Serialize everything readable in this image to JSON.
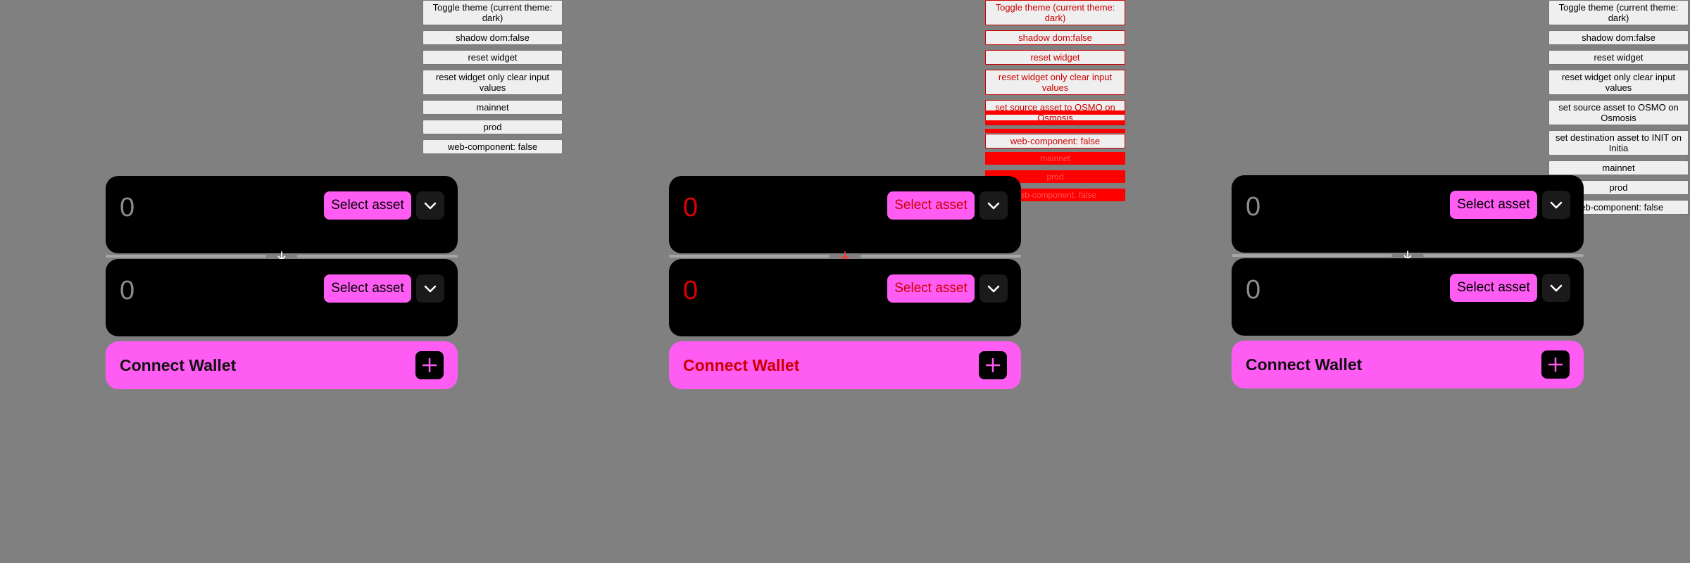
{
  "debug_buttons": {
    "toggle_theme": "Toggle theme (current theme: dark)",
    "shadow_dom": "shadow dom:false",
    "reset_widget": "reset widget",
    "reset_clear": "reset widget only clear input values",
    "set_source": "set source asset to OSMO on Osmosis",
    "set_destination": "set destination asset to INIT on Initia",
    "mainnet": "mainnet",
    "prod": "prod",
    "web_component": "web-component: false"
  },
  "overlap_labels": {
    "mainnet": "mainnet",
    "prod": "prod",
    "web_component": "web-component: false"
  },
  "widget": {
    "source_amount": "0",
    "destination_amount": "0",
    "select_asset": "Select asset",
    "connect_wallet": "Connect Wallet"
  },
  "icons": {
    "chevron": "chevron-down-icon",
    "swap_arrow": "arrow-down-icon",
    "plus": "plus-icon"
  },
  "colors": {
    "background": "#808080",
    "accent": "#ff5cf4",
    "card": "#000000",
    "overlap_red": "#ff0000"
  }
}
